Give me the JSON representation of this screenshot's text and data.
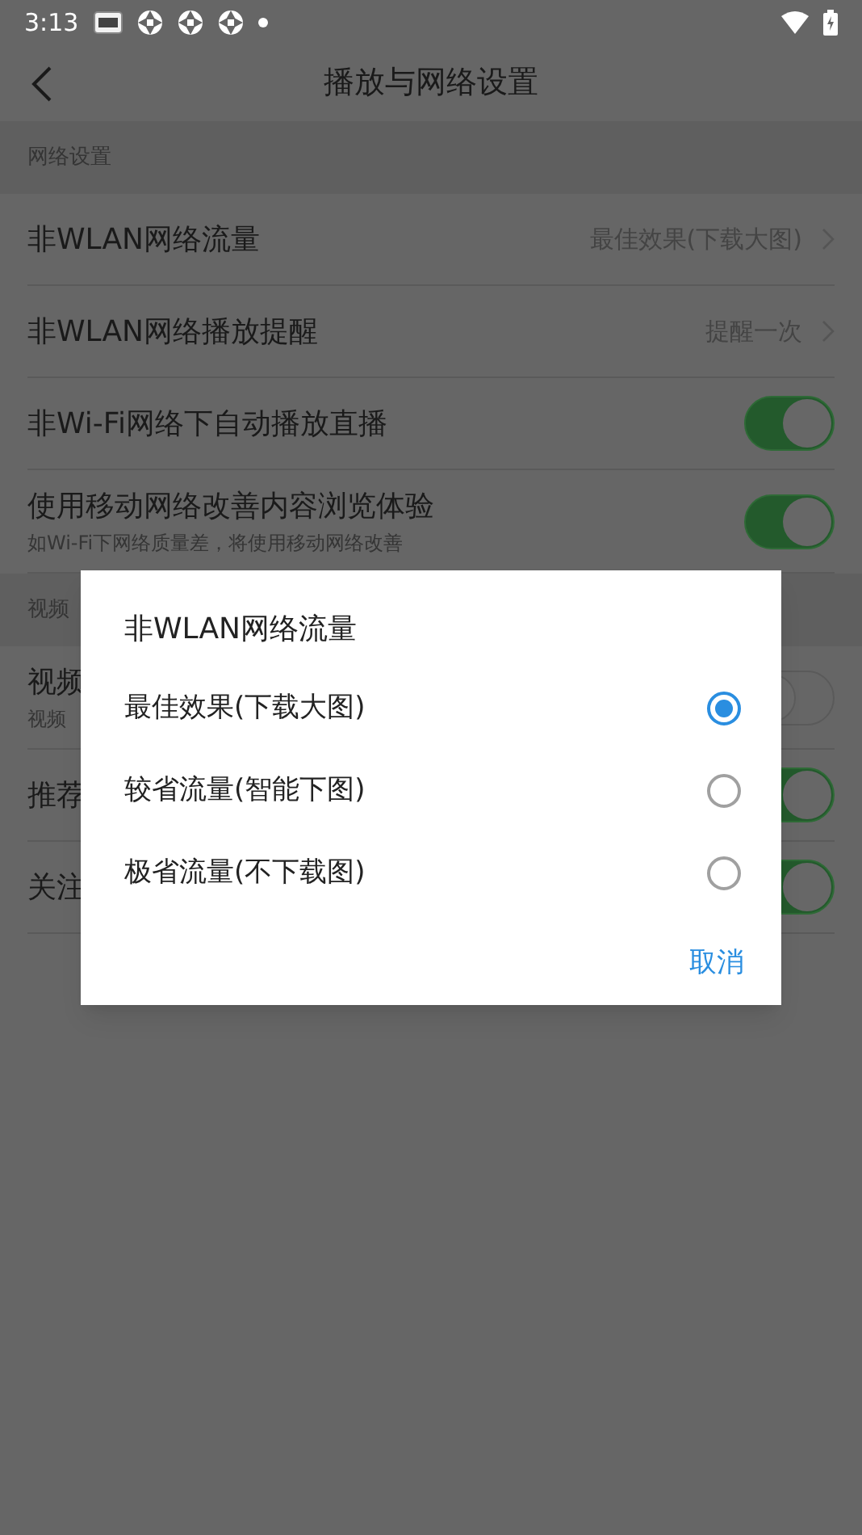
{
  "status_bar": {
    "time": "3:13"
  },
  "header": {
    "title": "播放与网络设置"
  },
  "sections": [
    {
      "title": "网络设置",
      "items": [
        {
          "kind": "link",
          "label": "非WLAN网络流量",
          "value": "最佳效果(下载大图)"
        },
        {
          "kind": "link",
          "label": "非WLAN网络播放提醒",
          "value": "提醒一次"
        },
        {
          "kind": "toggle",
          "label": "非Wi-Fi网络下自动播放直播",
          "on": true
        },
        {
          "kind": "toggle",
          "label": "使用移动网络改善内容浏览体验",
          "subtitle": "如Wi-Fi下网络质量差，将使用移动网络改善",
          "on": true
        }
      ]
    },
    {
      "title": "视频",
      "items": [
        {
          "kind": "toggle",
          "label": "视频",
          "subtitle": "视频",
          "on": false
        },
        {
          "kind": "toggle",
          "label": "推荐",
          "on": true
        },
        {
          "kind": "toggle",
          "label": "关注",
          "on": true
        }
      ]
    }
  ],
  "dialog": {
    "title": "非WLAN网络流量",
    "options": [
      {
        "label": "最佳效果(下载大图)",
        "selected": true
      },
      {
        "label": "较省流量(智能下图)",
        "selected": false
      },
      {
        "label": "极省流量(不下载图)",
        "selected": false
      }
    ],
    "cancel": "取消"
  }
}
